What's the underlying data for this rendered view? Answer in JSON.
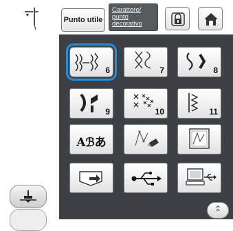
{
  "header": {
    "utility_label": "Punto utile",
    "decorative_label": "Carattere/\npunto\ndecorativo"
  },
  "tiles": [
    {
      "number": "6"
    },
    {
      "number": "7"
    },
    {
      "number": "8"
    },
    {
      "number": "9"
    },
    {
      "number": "10"
    },
    {
      "number": "11"
    }
  ],
  "icons": {
    "needle": "needle-icon",
    "lock": "lock-icon",
    "home": "home-icon",
    "presser_foot": "presser-foot-icon",
    "scroll_up": "double-chevron-up-icon"
  },
  "text_tile": {
    "label": "Aℬあ"
  },
  "colors": {
    "panel": "#3d4145",
    "selection": "#2a8bd6",
    "decor_button": "#555a5e"
  }
}
